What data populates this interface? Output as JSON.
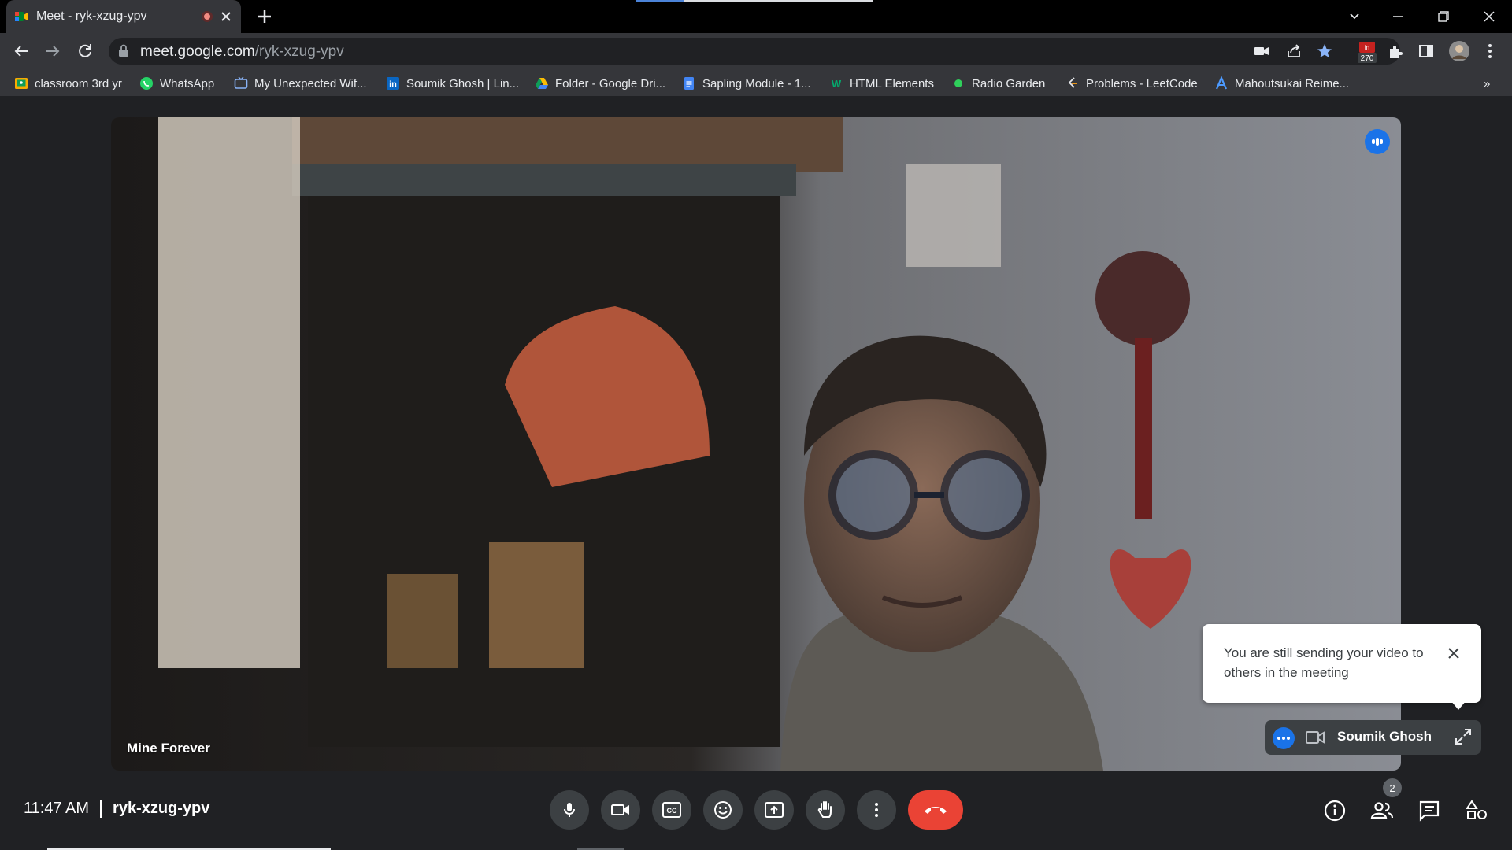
{
  "browser": {
    "tab_title": "Meet - ryk-xzug-ypv",
    "url_host": "meet.google.com",
    "url_path": "/ryk-xzug-ypv",
    "extension_badge": "270",
    "bookmarks": [
      {
        "label": "classroom 3rd yr",
        "icon": "classroom-icon"
      },
      {
        "label": "WhatsApp",
        "icon": "whatsapp-icon"
      },
      {
        "label": "My Unexpected Wif...",
        "icon": "tv-icon"
      },
      {
        "label": "Soumik Ghosh | Lin...",
        "icon": "linkedin-icon"
      },
      {
        "label": "Folder - Google Dri...",
        "icon": "google-drive-icon"
      },
      {
        "label": "Sapling Module - 1...",
        "icon": "google-docs-icon"
      },
      {
        "label": "HTML Elements",
        "icon": "w3schools-icon"
      },
      {
        "label": "Radio Garden",
        "icon": "radio-garden-icon"
      },
      {
        "label": "Problems - LeetCode",
        "icon": "leetcode-icon"
      },
      {
        "label": "Mahoutsukai Reime...",
        "icon": "anime-site-icon"
      }
    ],
    "bookmarks_overflow": "»"
  },
  "meeting": {
    "remote_participant": "Mine Forever",
    "self_name": "Soumik Ghosh",
    "toast_text": "You are still sending your video to others in the meeting",
    "time": "11:47 AM",
    "code": "ryk-xzug-ypv",
    "participant_count": "2"
  },
  "colors": {
    "accent": "#1a73e8",
    "end_call": "#ea4335",
    "background": "#202124",
    "control": "#3c4043"
  }
}
